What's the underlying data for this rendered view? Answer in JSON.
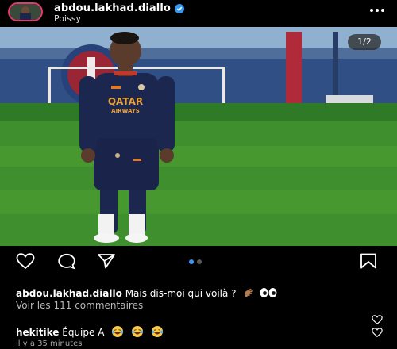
{
  "post": {
    "username": "abdou.lakhad.diallo",
    "location": "Poissy",
    "media_counter": "1/2",
    "jersey_text": [
      "QATAR",
      "AIRWAYS"
    ]
  },
  "caption": {
    "username": "abdou.lakhad.diallo",
    "text": "Mais dis-moi qui voilà ?",
    "view_comments": "Voir les 111 commentaires"
  },
  "comment": {
    "username": "hekitike",
    "text": "Équipe A",
    "time": "il y a 35 minutes"
  },
  "carousel": {
    "total": 2,
    "active": 1
  },
  "colors": {
    "background": "#000000",
    "verified": "#3897f0",
    "active_dot": "#3897f0",
    "inactive_dot": "#5a5a5a",
    "grass": "#3f8f2e",
    "kit": "#1c2750",
    "story_ring": "#e23a6f"
  },
  "icons": {
    "avatar": "profile-photo",
    "verified": "verified-badge-icon",
    "more": "more-dots-icon",
    "like": "heart-icon",
    "comment": "comment-bubble-icon",
    "share": "send-icon",
    "save": "bookmark-icon",
    "comment_like": "heart-icon"
  }
}
